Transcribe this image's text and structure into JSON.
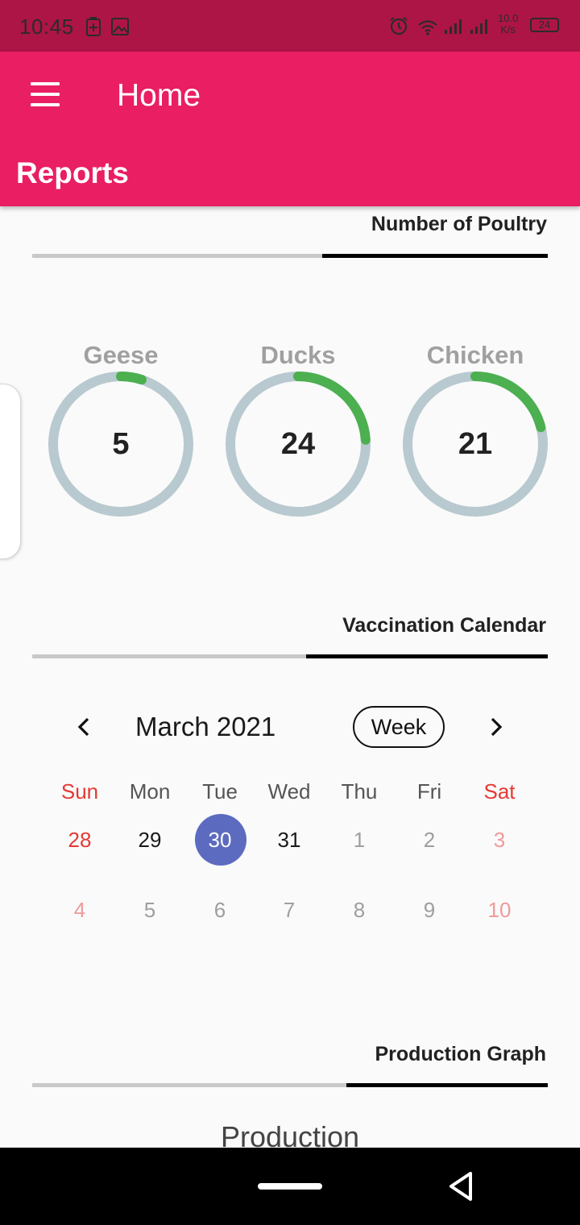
{
  "status_bar": {
    "time": "10:45",
    "speed_value": "10.0",
    "speed_unit": "K/s",
    "battery": "24"
  },
  "app_bar": {
    "title": "Home",
    "subtitle": "Reports"
  },
  "sections": {
    "poultry": "Number of Poultry",
    "vaccination": "Vaccination Calendar",
    "production": "Production Graph"
  },
  "poultry": [
    {
      "label": "Geese",
      "value": "5",
      "progress": 0.05
    },
    {
      "label": "Ducks",
      "value": "24",
      "progress": 0.24
    },
    {
      "label": "Chicken",
      "value": "21",
      "progress": 0.21
    }
  ],
  "calendar": {
    "month": "March 2021",
    "view_button": "Week",
    "prev_icon": "chevron-left",
    "next_icon": "chevron-right",
    "weekdays": [
      "Sun",
      "Mon",
      "Tue",
      "Wed",
      "Thu",
      "Fri",
      "Sat"
    ],
    "week1": [
      "28",
      "29",
      "30",
      "31",
      "1",
      "2",
      "3"
    ],
    "week2": [
      "4",
      "5",
      "6",
      "7",
      "8",
      "9",
      "10"
    ],
    "selected": "30"
  },
  "production": {
    "chart_title": "Production"
  },
  "colors": {
    "status_bar": "#ad1546",
    "app_bar": "#e91e63",
    "gauge_track": "#b8c9cf",
    "gauge_fill": "#4caf50",
    "selected_day": "#5c6bc0",
    "weekend": "#e53935"
  }
}
